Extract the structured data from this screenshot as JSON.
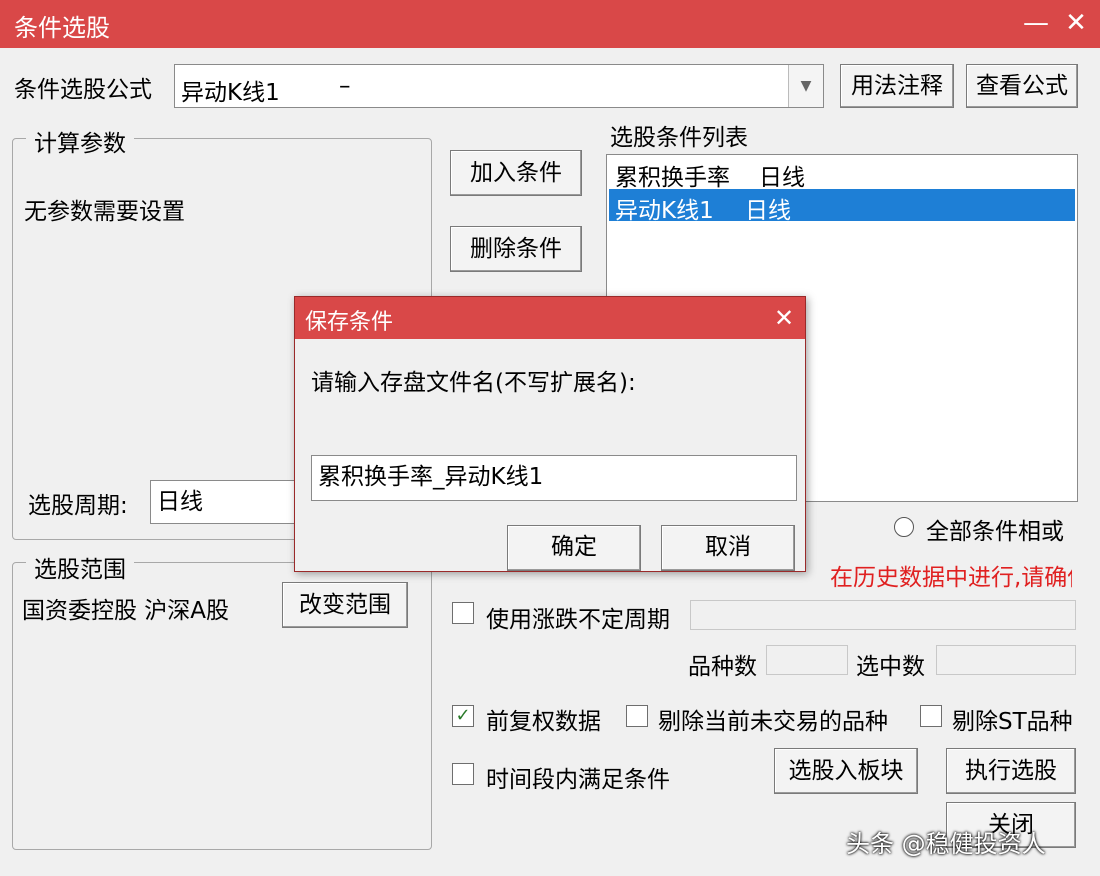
{
  "window": {
    "title": "条件选股",
    "minimize": "—",
    "close": "✕"
  },
  "formula": {
    "label": "条件选股公式",
    "value": "异动K线1",
    "suffix": "–",
    "dropdown": "▼"
  },
  "buttons": {
    "usage_notes": "用法注释",
    "view_formula": "查看公式",
    "add_condition": "加入条件",
    "delete_condition": "删除条件",
    "change_range": "改变范围",
    "to_block": "选股入板块",
    "execute": "执行选股",
    "close": "关闭"
  },
  "calc_params": {
    "legend": "计算参数",
    "message": "无参数需要设置",
    "period_label": "选股周期:",
    "period_value": "日线"
  },
  "condition_list": {
    "label": "选股条件列表",
    "items": [
      {
        "name": "累积换手率",
        "period": "日线"
      },
      {
        "name": "异动K线1",
        "period": "日线"
      }
    ]
  },
  "logic": {
    "or_label": "全部条件相或"
  },
  "warning": "在历史数据中进行,请确保数据完整",
  "range": {
    "legend": "选股范围",
    "value": "国资委控股 沪深A股"
  },
  "options": {
    "use_variable_period": "使用涨跌不定周期",
    "count_label": "品种数",
    "selected_label": "选中数",
    "forward_adjusted": "前复权数据",
    "forward_adjusted_checked": "✓",
    "exclude_untraded": "剔除当前未交易的品种",
    "exclude_st": "剔除ST品种",
    "time_range": "时间段内满足条件"
  },
  "save_dialog": {
    "title": "保存条件",
    "close": "✕",
    "prompt": "请输入存盘文件名(不写扩展名):",
    "filename": "累积换手率_异动K线1",
    "ok": "确定",
    "cancel": "取消"
  },
  "watermark": "头条 @稳健投资人",
  "colors": {
    "title_bar": "#d94848",
    "selection": "#1e7fd6",
    "warning": "#e02020"
  }
}
